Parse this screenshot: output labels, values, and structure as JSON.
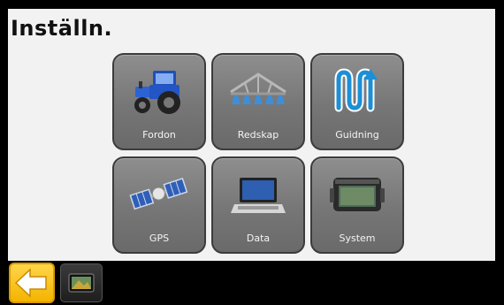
{
  "header": {
    "title": "Inställn."
  },
  "tiles": [
    {
      "label": "Fordon",
      "icon": "tractor-icon"
    },
    {
      "label": "Redskap",
      "icon": "sprayer-boom-icon"
    },
    {
      "label": "Guidning",
      "icon": "guidance-path-icon"
    },
    {
      "label": "GPS",
      "icon": "satellite-icon"
    },
    {
      "label": "Data",
      "icon": "laptop-icon"
    },
    {
      "label": "System",
      "icon": "display-unit-icon"
    }
  ],
  "bottom_bar": {
    "back_icon": "back-arrow-icon",
    "display_icon": "display-terminal-icon"
  },
  "colors": {
    "accent": "#f4b400",
    "tile": "#7a7a7a",
    "background": "#f2f2f2",
    "frame": "#000000"
  }
}
